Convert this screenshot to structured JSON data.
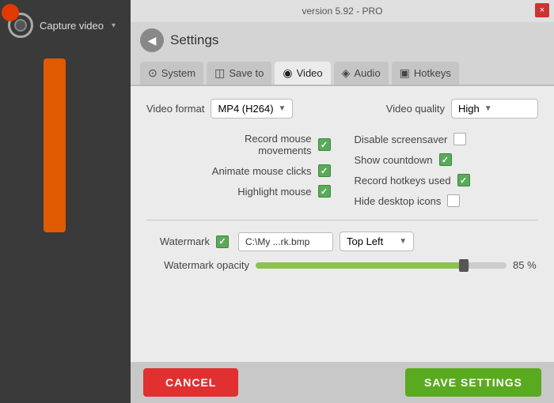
{
  "titleBar": {
    "version": "version 5.92 - PRO",
    "closeLabel": "×"
  },
  "sidebar": {
    "captureLabel": "Capture video",
    "chevron": "▾"
  },
  "header": {
    "backIcon": "◀",
    "settingsTitle": "Settings"
  },
  "tabs": [
    {
      "id": "system",
      "label": "System",
      "icon": "⊙"
    },
    {
      "id": "saveto",
      "label": "Save to",
      "icon": "◫"
    },
    {
      "id": "video",
      "label": "Video",
      "icon": "◉",
      "active": true
    },
    {
      "id": "audio",
      "label": "Audio",
      "icon": "◈"
    },
    {
      "id": "hotkeys",
      "label": "Hotkeys",
      "icon": "▣"
    }
  ],
  "videoSettings": {
    "formatLabel": "Video format",
    "formatValue": "MP4 (H264)",
    "qualityLabel": "Video quality",
    "qualityValue": "High",
    "checkboxes": {
      "left": [
        {
          "id": "record-mouse",
          "label": "Record mouse\nmovements",
          "checked": true
        },
        {
          "id": "animate-clicks",
          "label": "Animate mouse clicks",
          "checked": true
        },
        {
          "id": "highlight-mouse",
          "label": "Highlight mouse",
          "checked": true
        }
      ],
      "right": [
        {
          "id": "disable-screensaver",
          "label": "Disable screensaver",
          "checked": false
        },
        {
          "id": "show-countdown",
          "label": "Show countdown",
          "checked": true
        },
        {
          "id": "record-hotkeys",
          "label": "Record hotkeys used",
          "checked": true
        },
        {
          "id": "hide-desktop",
          "label": "Hide desktop icons",
          "checked": false
        }
      ]
    },
    "watermarkLabel": "Watermark",
    "watermarkChecked": true,
    "watermarkPath": "C:\\My ...rk.bmp",
    "watermarkPosition": "Top Left",
    "opacityLabel": "Watermark opacity",
    "opacityValue": "85 %"
  },
  "buttons": {
    "cancel": "CANCEL",
    "save": "SAVE SETTINGS"
  }
}
